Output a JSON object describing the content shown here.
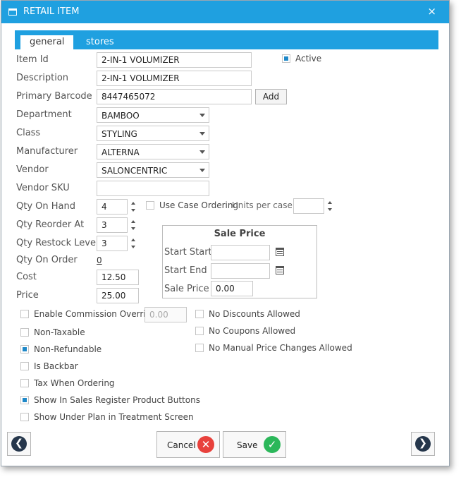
{
  "window": {
    "title": "RETAIL ITEM",
    "close_glyph": "×"
  },
  "tabs": [
    {
      "label": "general",
      "active": true
    },
    {
      "label": "stores",
      "active": false
    }
  ],
  "form": {
    "item_id": {
      "label": "Item Id",
      "value": "2-IN-1 VOLUMIZER"
    },
    "active": {
      "label": "Active",
      "checked": true
    },
    "description": {
      "label": "Description",
      "value": "2-IN-1 VOLUMIZER"
    },
    "primary_barcode": {
      "label": "Primary Barcode",
      "value": "8447465072",
      "add_label": "Add"
    },
    "department": {
      "label": "Department",
      "value": "BAMBOO"
    },
    "class": {
      "label": "Class",
      "value": "STYLING"
    },
    "manufacturer": {
      "label": "Manufacturer",
      "value": "ALTERNA"
    },
    "vendor": {
      "label": "Vendor",
      "value": "SALONCENTRIC"
    },
    "vendor_sku": {
      "label": "Vendor SKU",
      "value": ""
    },
    "qty_on_hand": {
      "label": "Qty On Hand",
      "value": "4"
    },
    "use_case_ordering": {
      "label": "Use Case Ordering",
      "checked": false
    },
    "units_per_case": {
      "label": "Units per case",
      "value": ""
    },
    "qty_reorder_at": {
      "label": "Qty Reorder At",
      "value": "3"
    },
    "qty_restock_level": {
      "label": "Qty Restock Level",
      "value": "3"
    },
    "qty_on_order": {
      "label": "Qty On Order",
      "value": "0"
    },
    "cost": {
      "label": "Cost",
      "value": "12.50"
    },
    "price": {
      "label": "Price",
      "value": "25.00"
    }
  },
  "sale_price": {
    "title": "Sale Price",
    "start_start": {
      "label": "Start Start",
      "value": ""
    },
    "start_end": {
      "label": "Start End",
      "value": ""
    },
    "sale_price": {
      "label": "Sale Price",
      "value": "0.00"
    }
  },
  "options_left": [
    {
      "label": "Enable Commission Override",
      "checked": false
    },
    {
      "label": "Non-Taxable",
      "checked": false
    },
    {
      "label": "Non-Refundable",
      "checked": true
    },
    {
      "label": "Is Backbar",
      "checked": false
    },
    {
      "label": "Tax When Ordering",
      "checked": false
    },
    {
      "label": "Show In Sales Register Product Buttons",
      "checked": true
    },
    {
      "label": "Show Under Plan in Treatment Screen",
      "checked": false
    }
  ],
  "commission_override_value": "0.00",
  "options_right": [
    {
      "label": "No Discounts Allowed",
      "checked": false
    },
    {
      "label": "No Coupons Allowed",
      "checked": false
    },
    {
      "label": "No Manual Price Changes Allowed",
      "checked": false
    }
  ],
  "footer": {
    "cancel_label": "Cancel",
    "save_label": "Save",
    "cancel_glyph": "✕",
    "save_glyph": "✓",
    "prev_glyph": "❮",
    "next_glyph": "❯"
  },
  "colors": {
    "accent": "#1fa0e0",
    "cancel_red": "#e8413c",
    "save_green": "#2bb75a",
    "nav_dark": "#25364b",
    "checkbox_blue": "#1e88c8"
  }
}
